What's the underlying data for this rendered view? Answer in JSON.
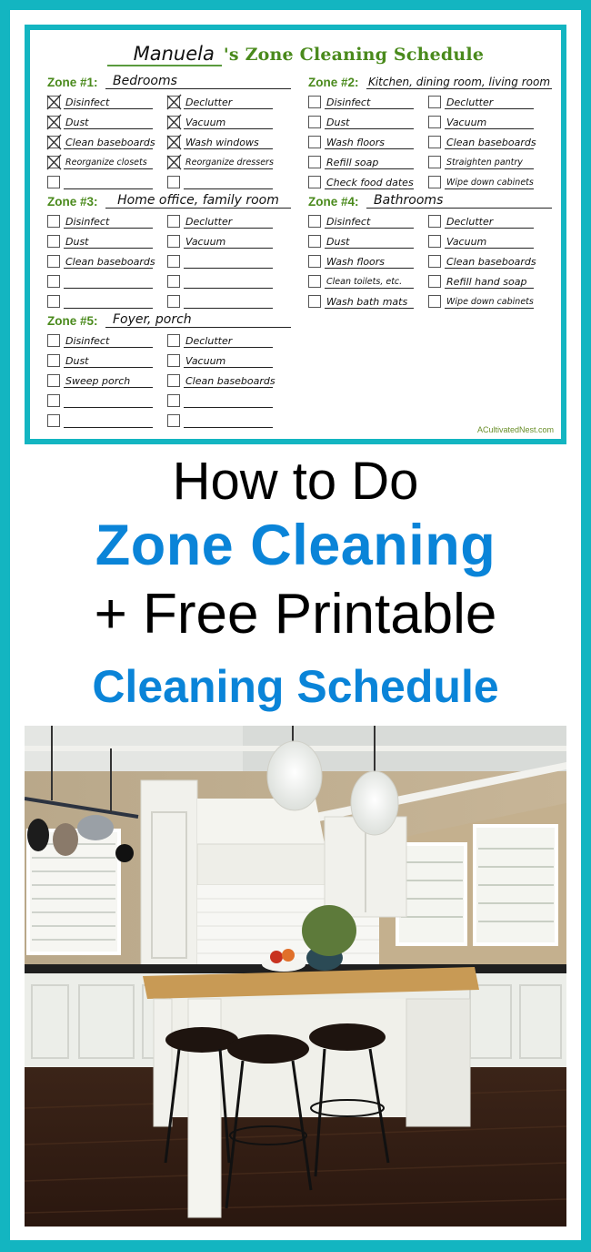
{
  "schedule": {
    "owner_name": "Manuela",
    "title_suffix": "'s Zone Cleaning Schedule",
    "watermark": "ACultivatedNest.com",
    "zones": [
      {
        "label": "Zone #1:",
        "name": "Bedrooms",
        "tasks": [
          {
            "text": "Disinfect",
            "checked": true
          },
          {
            "text": "Declutter",
            "checked": true
          },
          {
            "text": "Dust",
            "checked": true
          },
          {
            "text": "Vacuum",
            "checked": true
          },
          {
            "text": "Clean baseboards",
            "checked": true
          },
          {
            "text": "Wash windows",
            "checked": true
          },
          {
            "text": "Reorganize closets",
            "checked": true
          },
          {
            "text": "Reorganize dressers",
            "checked": true
          },
          {
            "text": "",
            "checked": false
          },
          {
            "text": "",
            "checked": false
          }
        ]
      },
      {
        "label": "Zone #2:",
        "name": "Kitchen, dining room, living room",
        "tasks": [
          {
            "text": "Disinfect",
            "checked": false
          },
          {
            "text": "Declutter",
            "checked": false
          },
          {
            "text": "Dust",
            "checked": false
          },
          {
            "text": "Vacuum",
            "checked": false
          },
          {
            "text": "Wash floors",
            "checked": false
          },
          {
            "text": "Clean baseboards",
            "checked": false
          },
          {
            "text": "Refill soap",
            "checked": false
          },
          {
            "text": "Straighten pantry",
            "checked": false
          },
          {
            "text": "Check food dates",
            "checked": false
          },
          {
            "text": "Wipe down cabinets",
            "checked": false
          }
        ]
      },
      {
        "label": "Zone #3:",
        "name": "Home office, family room",
        "tasks": [
          {
            "text": "Disinfect",
            "checked": false
          },
          {
            "text": "Declutter",
            "checked": false
          },
          {
            "text": "Dust",
            "checked": false
          },
          {
            "text": "Vacuum",
            "checked": false
          },
          {
            "text": "Clean baseboards",
            "checked": false
          },
          {
            "text": "",
            "checked": false
          },
          {
            "text": "",
            "checked": false
          },
          {
            "text": "",
            "checked": false
          },
          {
            "text": "",
            "checked": false
          },
          {
            "text": "",
            "checked": false
          }
        ]
      },
      {
        "label": "Zone #4:",
        "name": "Bathrooms",
        "tasks": [
          {
            "text": "Disinfect",
            "checked": false
          },
          {
            "text": "Declutter",
            "checked": false
          },
          {
            "text": "Dust",
            "checked": false
          },
          {
            "text": "Vacuum",
            "checked": false
          },
          {
            "text": "Wash floors",
            "checked": false
          },
          {
            "text": "Clean baseboards",
            "checked": false
          },
          {
            "text": "Clean toilets, etc.",
            "checked": false
          },
          {
            "text": "Refill hand soap",
            "checked": false
          },
          {
            "text": "Wash bath mats",
            "checked": false
          },
          {
            "text": "Wipe down cabinets",
            "checked": false
          }
        ]
      },
      {
        "label": "Zone #5:",
        "name": "Foyer, porch",
        "tasks": [
          {
            "text": "Disinfect",
            "checked": false
          },
          {
            "text": "Declutter",
            "checked": false
          },
          {
            "text": "Dust",
            "checked": false
          },
          {
            "text": "Vacuum",
            "checked": false
          },
          {
            "text": "Sweep porch",
            "checked": false
          },
          {
            "text": "Clean baseboards",
            "checked": false
          },
          {
            "text": "",
            "checked": false
          },
          {
            "text": "",
            "checked": false
          },
          {
            "text": "",
            "checked": false
          },
          {
            "text": "",
            "checked": false
          }
        ]
      }
    ]
  },
  "headline": {
    "line1": "How to Do",
    "line2": "Zone Cleaning",
    "line3": "+ Free Printable",
    "line4": "Cleaning Schedule"
  },
  "photo": {
    "subject": "white kitchen with wooden island, bar stools and pendant lights"
  },
  "colors": {
    "frame": "#13b5c1",
    "accent_blue": "#0a84d8",
    "zone_green": "#4a8a1c"
  }
}
